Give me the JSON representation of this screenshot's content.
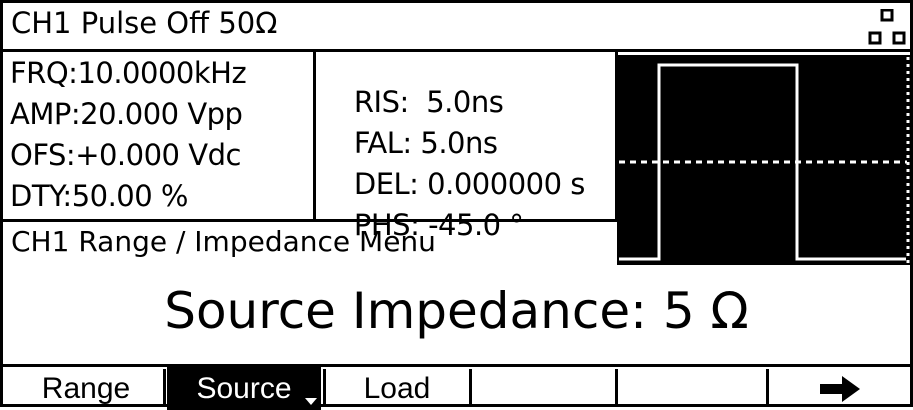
{
  "header": {
    "title": "CH1   Pulse Off 50Ω",
    "channel_icon": "dual-channel-icon"
  },
  "params": {
    "left": [
      {
        "label": "FRQ:",
        "value": "10.0000kHz"
      },
      {
        "label": "AMP:",
        "value": "20.000 Vpp"
      },
      {
        "label": "OFS:",
        "value": "+0.000 Vdc"
      },
      {
        "label": "DTY:",
        "value": "50.00 %"
      }
    ],
    "right": [
      {
        "label": "RIS:",
        "value": "  5.0ns"
      },
      {
        "label": "FAL:",
        "value": " 5.0ns"
      },
      {
        "label": "DEL:",
        "value": " 0.000000 s"
      },
      {
        "label": "PHS:",
        "value": " -45.0 °"
      }
    ]
  },
  "menu": {
    "title": "CH1 Range / Impedance Menu"
  },
  "display": {
    "value_text": "Source Impedance: 5 Ω"
  },
  "softkeys": [
    {
      "label": "Range",
      "selected": false
    },
    {
      "label": "Source",
      "selected": true
    },
    {
      "label": "Load",
      "selected": false
    },
    {
      "label": "",
      "selected": false
    },
    {
      "label": "",
      "selected": false
    },
    {
      "label": "",
      "icon": "right-arrow-icon",
      "selected": false
    }
  ],
  "colors": {
    "background": "#ffffff",
    "foreground": "#000000",
    "waveform": "#ffffff"
  }
}
